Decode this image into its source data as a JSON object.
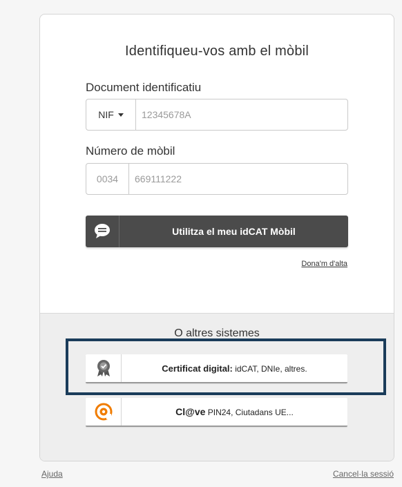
{
  "title": "Identifiqueu-vos amb el mòbil",
  "document": {
    "label": "Document identificatiu",
    "type_selected": "NIF",
    "placeholder": "12345678A"
  },
  "mobile": {
    "label": "Número de mòbil",
    "prefix": "0034",
    "placeholder": "669111222"
  },
  "primary_button": {
    "label": "Utilitza el meu idCAT Mòbil",
    "icon": "chat-bubble-icon"
  },
  "signup_link": "Dona'm d'alta",
  "others_heading": "O altres sistemes",
  "cert_button": {
    "bold": "Certificat digital:",
    "rest": " idCAT, DNIe, altres.",
    "icon": "certificate-ribbon-icon"
  },
  "clave_button": {
    "bold": "Cl@ve",
    "rest": " PIN24, Ciutadans UE...",
    "icon": "clave-logo-icon",
    "color": "#f07c00"
  },
  "highlight_color": "#1a3c5a",
  "footer": {
    "help": "Ajuda",
    "cancel": "Cancel·la sessió"
  }
}
